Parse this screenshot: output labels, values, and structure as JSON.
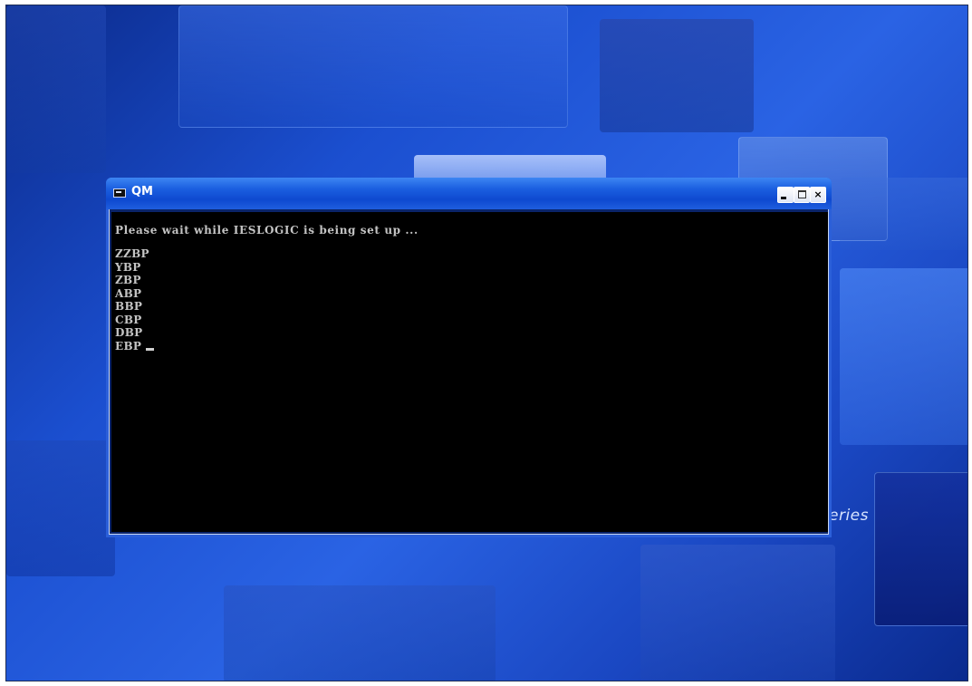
{
  "desktop": {
    "branding_text": "eries"
  },
  "window": {
    "title": "QM",
    "icon": "console-icon",
    "controls": {
      "minimize": "minimize-icon",
      "maximize": "maximize-icon",
      "close_label": "×"
    }
  },
  "console": {
    "header_line": "Please wait while IESLOGIC is being set up ...",
    "lines": [
      "ZZBP",
      "YBP",
      "ZBP",
      "ABP",
      "BBP",
      "CBP",
      "DBP",
      "EBP"
    ]
  },
  "colors": {
    "desktop_blue": "#1b4fd0",
    "titlebar_blue": "#0e49d0",
    "console_bg": "#000000",
    "console_text": "#c4c4c4"
  }
}
